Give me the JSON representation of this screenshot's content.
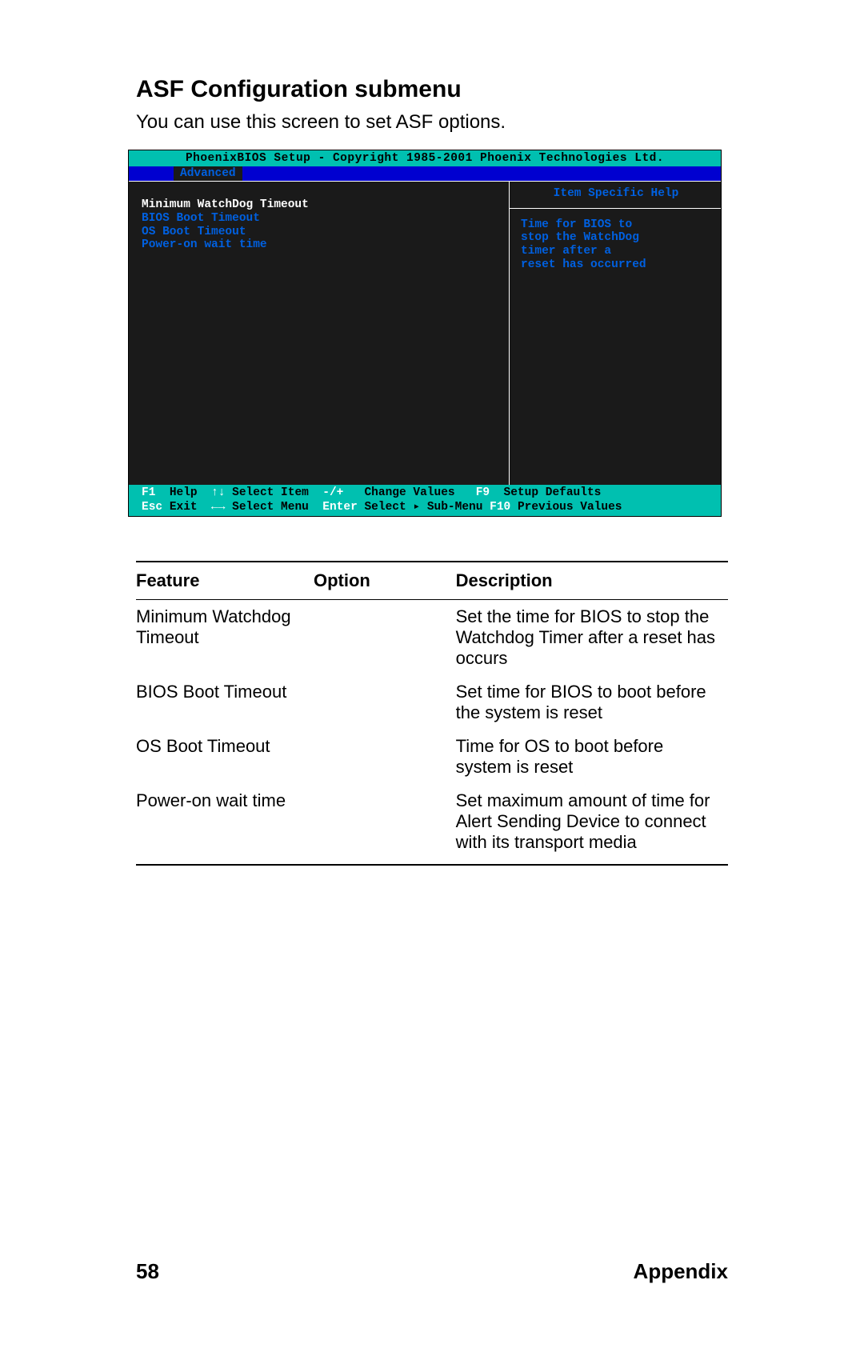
{
  "section": {
    "title": "ASF Configuration submenu",
    "subtitle": "You can use this screen to set ASF options."
  },
  "bios": {
    "titlebar": "PhoenixBIOS Setup - Copyright 1985-2001 Phoenix Technologies Ltd.",
    "tab": "Advanced",
    "menu": {
      "item0": "Minimum WatchDog Timeout",
      "item1": "BIOS Boot Timeout",
      "item2": "OS Boot Timeout",
      "item3": "Power-on wait time"
    },
    "help_title": "Item Specific Help",
    "help_text": "Time for BIOS to\nstop the WatchDog\ntimer after a\nreset has occurred",
    "footer": {
      "f1": "F1",
      "help": "Help",
      "updown": "↑↓",
      "select_item": "Select Item",
      "pm": "-/+",
      "change_values": "Change Values",
      "f9": "F9",
      "setup_defaults": "Setup Defaults",
      "esc": "Esc",
      "exit": "Exit",
      "lr": "←→",
      "select_menu": "Select Menu",
      "enter": "Enter",
      "sub_menu": "Select ▸ Sub-Menu",
      "f10": "F10",
      "prev_values": "Previous Values"
    }
  },
  "table": {
    "headers": {
      "feature": "Feature",
      "option": "Option",
      "description": "Description"
    },
    "rows": [
      {
        "feature": "Minimum Watchdog Timeout",
        "option": "",
        "description": "Set the time for BIOS to stop the Watchdog Timer after a reset has occurs"
      },
      {
        "feature": "BIOS Boot Timeout",
        "option": "",
        "description": "Set time for BIOS to boot before the system is reset"
      },
      {
        "feature": "OS Boot Timeout",
        "option": "",
        "description": "Time for OS to boot before system is reset"
      },
      {
        "feature": "Power-on wait time",
        "option": "",
        "description": "Set maximum amount of time for Alert Sending Device to connect with its transport media"
      }
    ]
  },
  "footer": {
    "page_number": "58",
    "section_label": "Appendix"
  }
}
